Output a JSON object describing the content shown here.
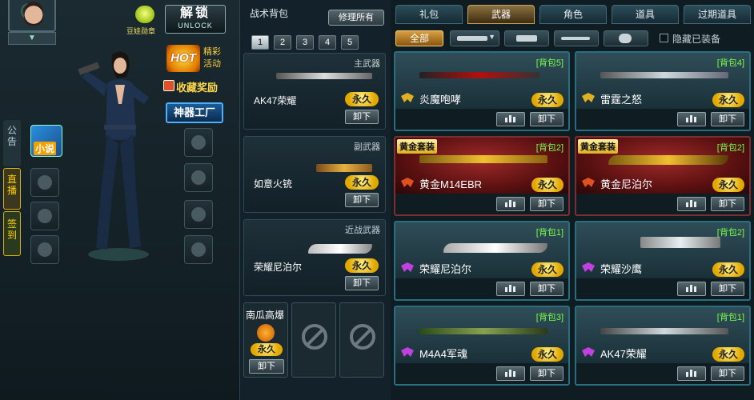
{
  "left": {
    "doll_label": "豆娃勋章",
    "unlock_big": "解锁",
    "unlock_small": "UNLOCK",
    "hot_badge": "HOT",
    "hot_text": "精彩活动",
    "collect_label": "收藏奖励",
    "factory_label": "神器工厂",
    "book_label": "小说",
    "side_tabs": [
      "公告",
      "直播",
      "签到"
    ]
  },
  "backpack": {
    "title": "战术背包",
    "repair_label": "修理所有",
    "pages": [
      "1",
      "2",
      "3",
      "4",
      "5"
    ],
    "active_page": "1",
    "slots": [
      {
        "category": "主武器",
        "name": "AK47荣耀",
        "perm": "永久",
        "unequip": "卸下"
      },
      {
        "category": "副武器",
        "name": "如意火铳",
        "perm": "永久",
        "unequip": "卸下"
      },
      {
        "category": "近战武器",
        "name": "荣耀尼泊尔",
        "perm": "永久",
        "unequip": "卸下"
      }
    ],
    "grenade": {
      "name": "南瓜高爆",
      "perm": "永久",
      "unequip": "卸下"
    }
  },
  "store": {
    "tabs": [
      "礼包",
      "武器",
      "角色",
      "道具",
      "过期道具"
    ],
    "active_tab": "武器",
    "filters": {
      "all": "全部"
    },
    "hide_equipped": "隐藏已装备",
    "cards": [
      {
        "bag": "[背包5]",
        "name": "炎魔咆哮",
        "perm": "永久",
        "unequip": "卸下",
        "gold": false,
        "tag": ""
      },
      {
        "bag": "[背包4]",
        "name": "雷霆之怒",
        "perm": "永久",
        "unequip": "卸下",
        "gold": false,
        "tag": ""
      },
      {
        "bag": "[背包2]",
        "name": "黄金M14EBR",
        "perm": "永久",
        "unequip": "卸下",
        "gold": true,
        "tag": "黄金套装"
      },
      {
        "bag": "[背包2]",
        "name": "黄金尼泊尔",
        "perm": "永久",
        "unequip": "卸下",
        "gold": true,
        "tag": "黄金套装"
      },
      {
        "bag": "[背包1]",
        "name": "荣耀尼泊尔",
        "perm": "永久",
        "unequip": "卸下",
        "gold": false,
        "tag": ""
      },
      {
        "bag": "[背包2]",
        "name": "荣耀沙鹰",
        "perm": "永久",
        "unequip": "卸下",
        "gold": false,
        "tag": ""
      },
      {
        "bag": "[背包3]",
        "name": "M4A4军魂",
        "perm": "永久",
        "unequip": "卸下",
        "gold": false,
        "tag": ""
      },
      {
        "bag": "[背包1]",
        "name": "AK47荣耀",
        "perm": "永久",
        "unequip": "卸下",
        "gold": false,
        "tag": ""
      }
    ]
  },
  "colors": {
    "accent_gold": "#e2a800",
    "bag_green": "#7aff4a",
    "gold_card_red": "#a02a2a"
  }
}
